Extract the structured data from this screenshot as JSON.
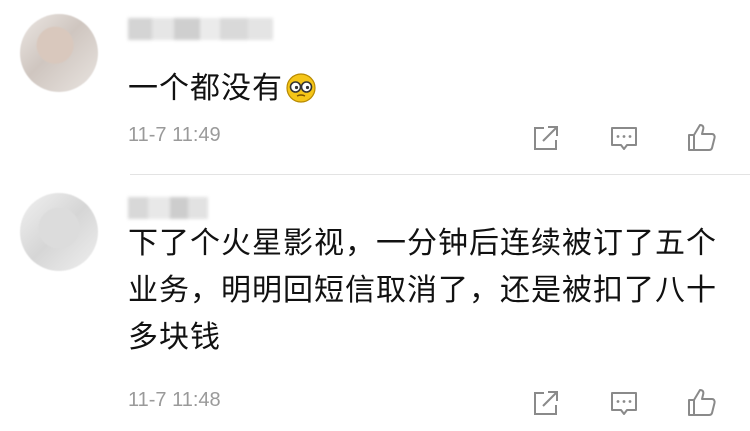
{
  "comments": [
    {
      "username_hidden": true,
      "text": "一个都没有",
      "emoji": "glasses-face-emoji",
      "timestamp": "11-7 11:49",
      "actions": {
        "share_icon": "share-icon",
        "reply_icon": "comment-icon",
        "like_icon": "thumbs-up-icon"
      }
    },
    {
      "username_hidden": true,
      "text": "下了个火星影视，一分钟后连续被订了五个业务，明明回短信取消了，还是被扣了八十多块钱",
      "timestamp": "11-7 11:48",
      "actions": {
        "share_icon": "share-icon",
        "reply_icon": "comment-icon",
        "like_icon": "thumbs-up-icon"
      }
    }
  ],
  "colors": {
    "text": "#111111",
    "meta": "#9a9a9a",
    "icon": "#8a8a8a",
    "divider": "#e3e3e3",
    "emoji": "#f5c518"
  }
}
